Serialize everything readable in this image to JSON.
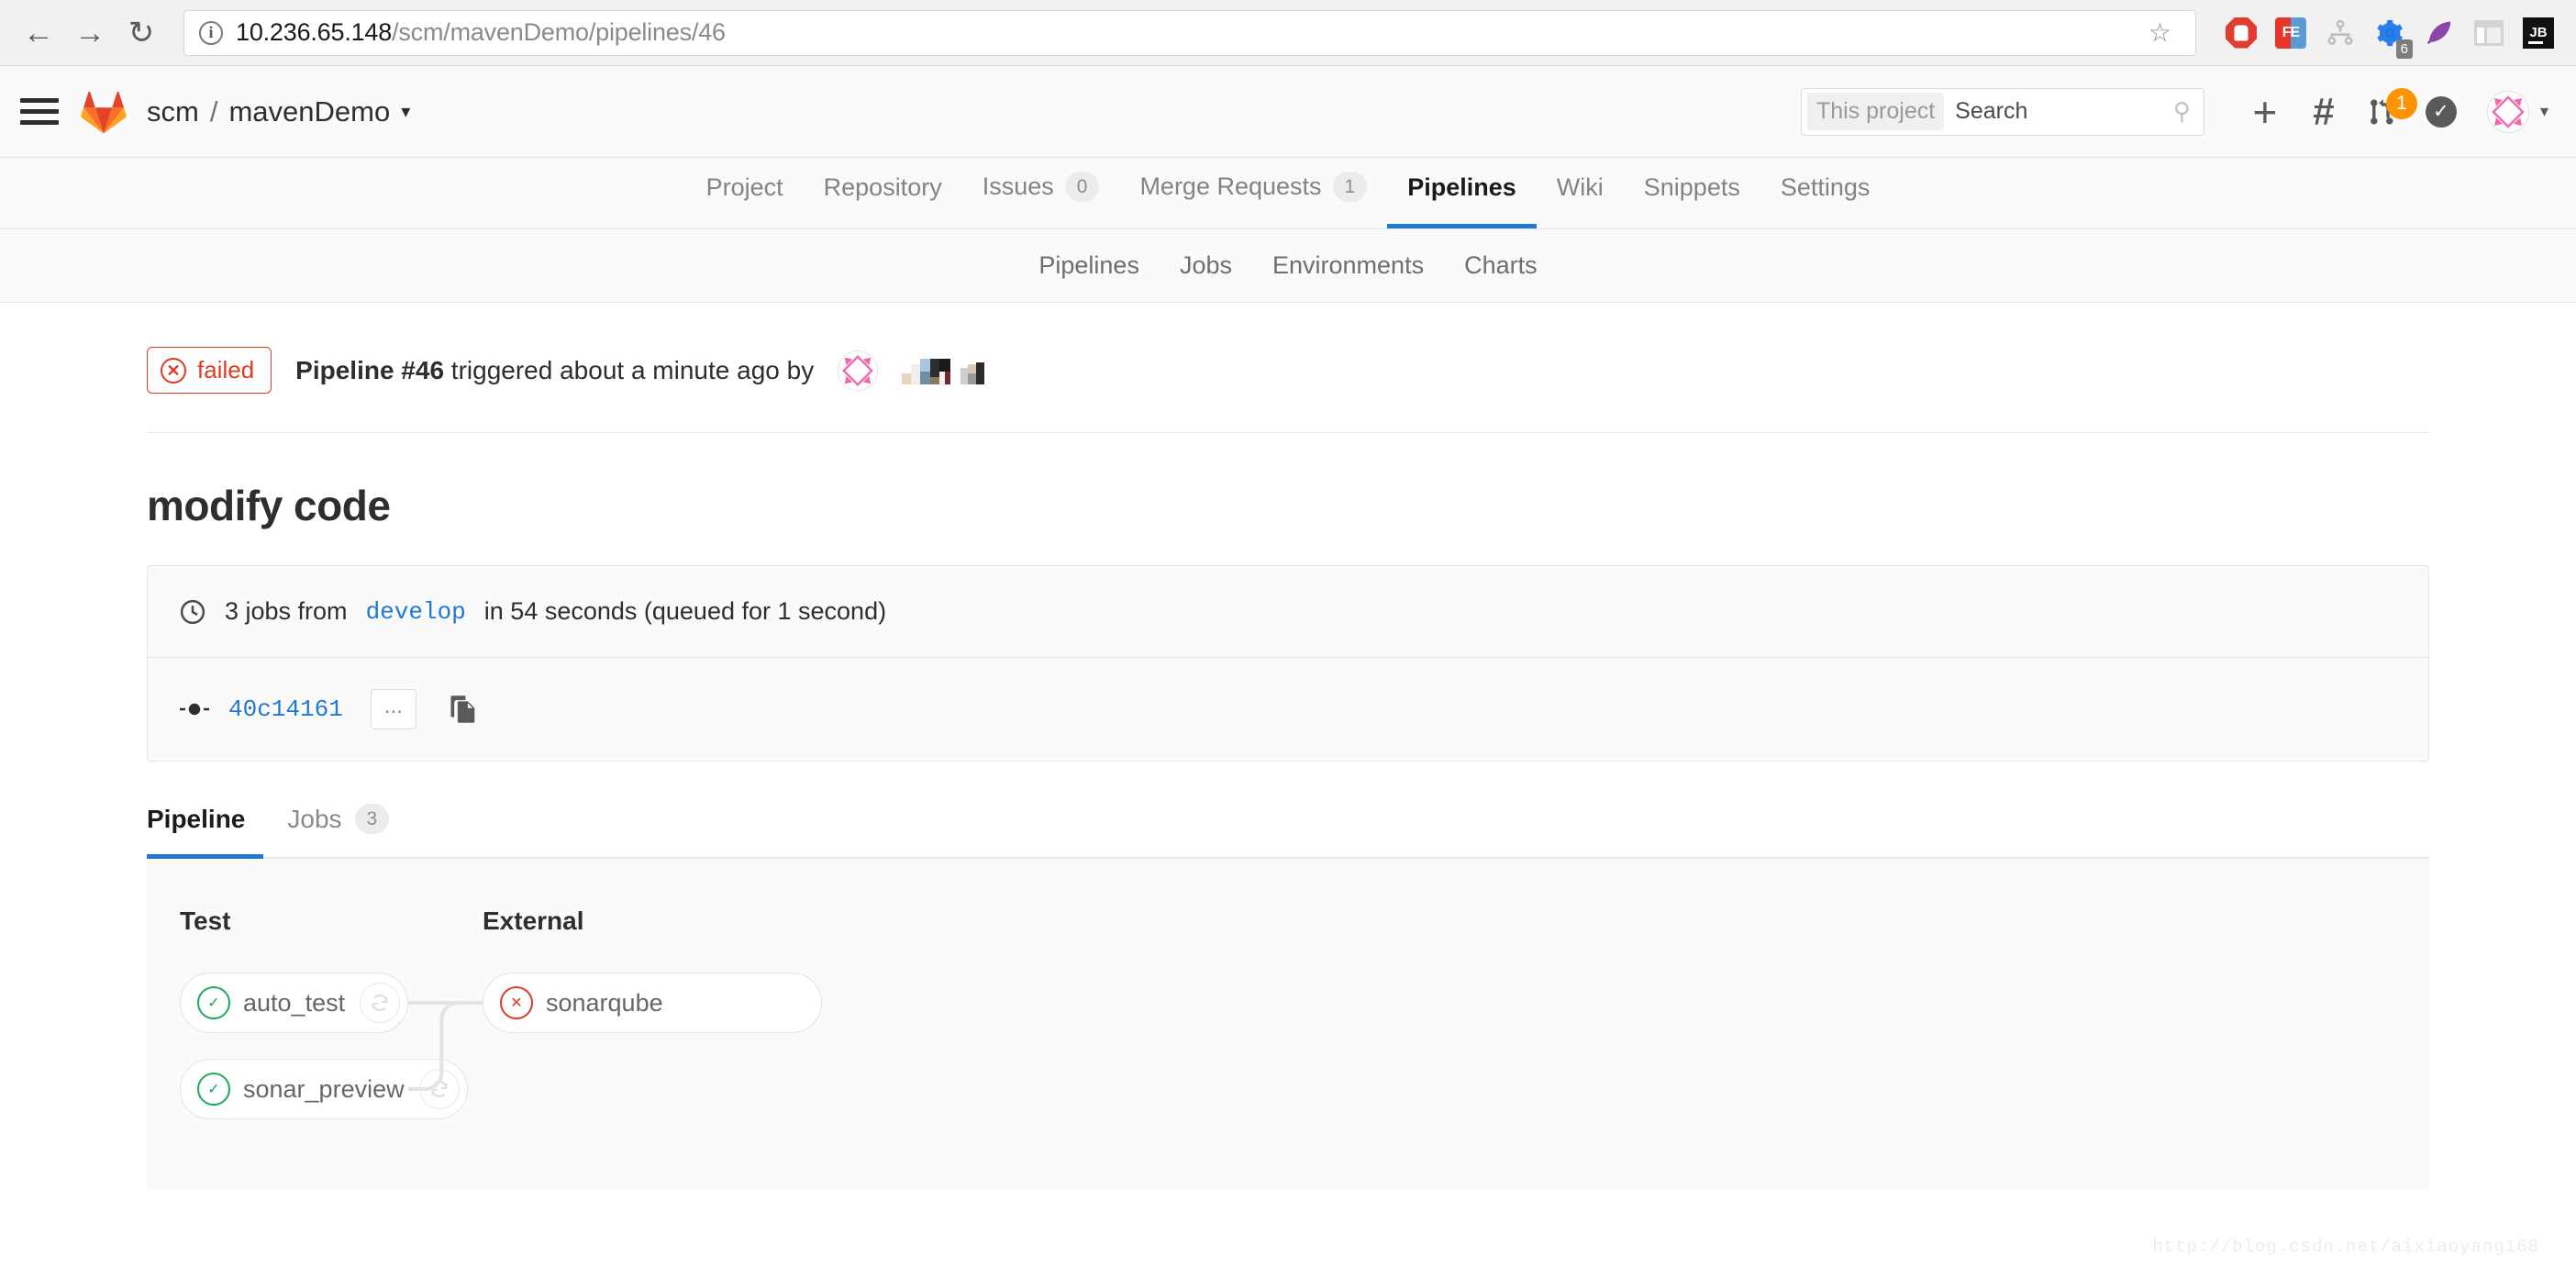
{
  "browser": {
    "back_icon": "back-arrow-icon",
    "forward_icon": "forward-arrow-icon",
    "reload_icon": "reload-icon",
    "url_host": "10.236.65.148",
    "url_path": "/scm/mavenDemo/pipelines/46",
    "bookmark_icon": "star-icon",
    "extensions": [
      {
        "name": "adblock-extension-icon",
        "label": ""
      },
      {
        "name": "fe-extension-icon",
        "label": "FE"
      },
      {
        "name": "sitemap-extension-icon",
        "label": ""
      },
      {
        "name": "gear-extension-icon",
        "label": "",
        "badge": "6"
      },
      {
        "name": "feather-extension-icon",
        "label": ""
      },
      {
        "name": "layout-extension-icon",
        "label": ""
      },
      {
        "name": "jetbrains-extension-icon",
        "label": "JB"
      }
    ]
  },
  "header": {
    "menu_icon": "hamburger-menu-icon",
    "logo_icon": "gitlab-tanuki-logo",
    "namespace": "scm",
    "separator": "/",
    "project": "mavenDemo",
    "project_caret": "chevron-down-icon",
    "search": {
      "scope": "This project",
      "placeholder": "Search",
      "value": "",
      "icon": "search-icon"
    },
    "actions": [
      {
        "name": "new-item-button",
        "glyph": "+"
      },
      {
        "name": "issues-button",
        "glyph": "#"
      },
      {
        "name": "merge-requests-button",
        "glyph": "merge-icon",
        "badge": "1"
      },
      {
        "name": "todos-button",
        "glyph": "check-icon"
      }
    ],
    "avatar_icon": "user-avatar",
    "avatar_caret": "chevron-down-icon"
  },
  "project_nav": [
    {
      "label": "Project",
      "count": null,
      "active": false
    },
    {
      "label": "Repository",
      "count": null,
      "active": false
    },
    {
      "label": "Issues",
      "count": "0",
      "active": false
    },
    {
      "label": "Merge Requests",
      "count": "1",
      "active": false
    },
    {
      "label": "Pipelines",
      "count": null,
      "active": true
    },
    {
      "label": "Wiki",
      "count": null,
      "active": false
    },
    {
      "label": "Snippets",
      "count": null,
      "active": false
    },
    {
      "label": "Settings",
      "count": null,
      "active": false
    }
  ],
  "sub_nav": [
    {
      "label": "Pipelines"
    },
    {
      "label": "Jobs"
    },
    {
      "label": "Environments"
    },
    {
      "label": "Charts"
    }
  ],
  "pipeline": {
    "status_label": "failed",
    "status_icon": "x-circle-icon",
    "status_color": "#db3b21",
    "title_bold": "Pipeline #46",
    "title_rest": " triggered about a minute ago by",
    "trigger_avatar": "user-avatar",
    "trigger_user": "",
    "commit_title": "modify code",
    "duration_icon": "clock-icon",
    "jobs_summary_prefix": "3 jobs from",
    "branch": "develop",
    "jobs_summary_suffix": "in 54 seconds (queued for 1 second)",
    "commit_icon": "commit-icon",
    "commit_sha": "40c14161",
    "ellipsis_label": "...",
    "copy_icon": "copy-to-clipboard-icon"
  },
  "tabs": [
    {
      "label": "Pipeline",
      "count": null,
      "active": true
    },
    {
      "label": "Jobs",
      "count": "3",
      "active": false
    }
  ],
  "graph": {
    "stages": [
      {
        "name": "Test",
        "jobs": [
          {
            "name": "auto_test",
            "status": "success",
            "status_icon": "check-circle-icon",
            "retry_icon": "retry-icon",
            "has_retry": true
          },
          {
            "name": "sonar_preview",
            "status": "success",
            "status_icon": "check-circle-icon",
            "retry_icon": "retry-icon",
            "has_retry": true
          }
        ]
      },
      {
        "name": "External",
        "jobs": [
          {
            "name": "sonarqube",
            "status": "failed",
            "status_icon": "x-circle-icon",
            "retry_icon": "",
            "has_retry": false
          }
        ]
      }
    ]
  },
  "watermark": "http://blog.csdn.net/aixiaoyang168"
}
